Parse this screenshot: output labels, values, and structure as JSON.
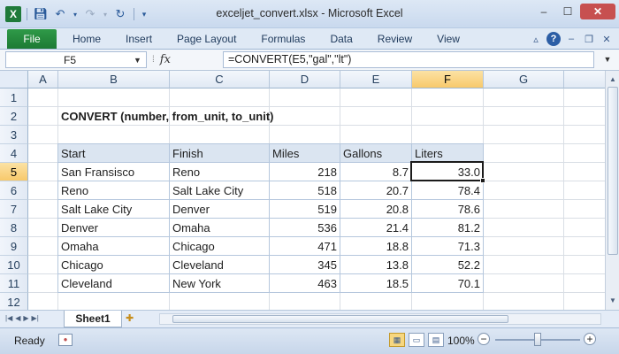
{
  "window": {
    "title": "exceljet_convert.xlsx - Microsoft Excel",
    "app_icon": "X"
  },
  "ribbon": {
    "file_label": "File",
    "tabs": [
      "Home",
      "Insert",
      "Page Layout",
      "Formulas",
      "Data",
      "Review",
      "View"
    ]
  },
  "formula_bar": {
    "name_box": "F5",
    "fx_label": "fx",
    "formula": "=CONVERT(E5,\"gal\",\"lt\")"
  },
  "grid": {
    "columns": [
      "A",
      "B",
      "C",
      "D",
      "E",
      "F",
      "G"
    ],
    "rows": [
      "1",
      "2",
      "3",
      "4",
      "5",
      "6",
      "7",
      "8",
      "9",
      "10",
      "11",
      "12"
    ],
    "active_cell": "F5",
    "title": "CONVERT (number, from_unit, to_unit)",
    "table_headers": [
      "Start",
      "Finish",
      "Miles",
      "Gallons",
      "Liters"
    ],
    "table_rows": [
      [
        "San Fransisco",
        "Reno",
        "218",
        "8.7",
        "33.0"
      ],
      [
        "Reno",
        "Salt Lake City",
        "518",
        "20.7",
        "78.4"
      ],
      [
        "Salt Lake City",
        "Denver",
        "519",
        "20.8",
        "78.6"
      ],
      [
        "Denver",
        "Omaha",
        "536",
        "21.4",
        "81.2"
      ],
      [
        "Omaha",
        "Chicago",
        "471",
        "18.8",
        "71.3"
      ],
      [
        "Chicago",
        "Cleveland",
        "345",
        "13.8",
        "52.2"
      ],
      [
        "Cleveland",
        "New York",
        "463",
        "18.5",
        "70.1"
      ]
    ]
  },
  "sheet_tabs": {
    "active": "Sheet1"
  },
  "status_bar": {
    "status": "Ready",
    "zoom": "100%"
  },
  "colors": {
    "file_tab": "#1d7a34",
    "header_fill": "#dbe5f1",
    "selected_header": "#f8c96b"
  }
}
